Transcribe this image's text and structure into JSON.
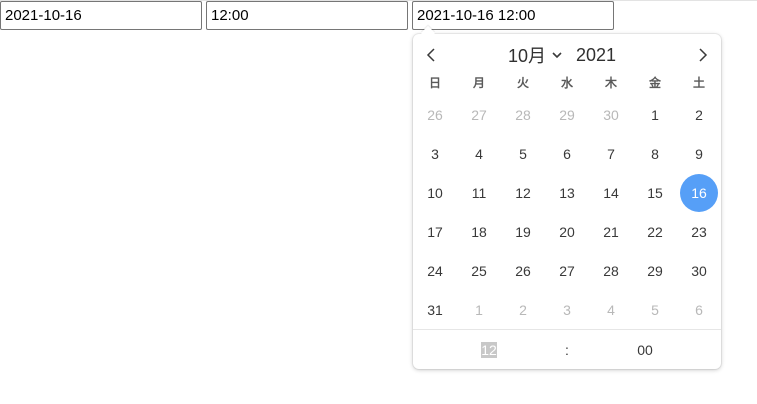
{
  "inputs": {
    "date_value": "2021-10-16",
    "time_value": "12:00",
    "datetime_value": "2021-10-16 12:00"
  },
  "picker": {
    "month_label": "10月",
    "year_value": "2021",
    "weekdays": [
      "日",
      "月",
      "火",
      "水",
      "木",
      "金",
      "土"
    ],
    "weeks": [
      [
        {
          "d": "26",
          "m": true
        },
        {
          "d": "27",
          "m": true
        },
        {
          "d": "28",
          "m": true
        },
        {
          "d": "29",
          "m": true
        },
        {
          "d": "30",
          "m": true
        },
        {
          "d": "1",
          "m": false
        },
        {
          "d": "2",
          "m": false
        }
      ],
      [
        {
          "d": "3",
          "m": false
        },
        {
          "d": "4",
          "m": false
        },
        {
          "d": "5",
          "m": false
        },
        {
          "d": "6",
          "m": false
        },
        {
          "d": "7",
          "m": false
        },
        {
          "d": "8",
          "m": false
        },
        {
          "d": "9",
          "m": false
        }
      ],
      [
        {
          "d": "10",
          "m": false
        },
        {
          "d": "11",
          "m": false
        },
        {
          "d": "12",
          "m": false
        },
        {
          "d": "13",
          "m": false
        },
        {
          "d": "14",
          "m": false
        },
        {
          "d": "15",
          "m": false
        },
        {
          "d": "16",
          "m": false,
          "sel": true
        }
      ],
      [
        {
          "d": "17",
          "m": false
        },
        {
          "d": "18",
          "m": false
        },
        {
          "d": "19",
          "m": false
        },
        {
          "d": "20",
          "m": false
        },
        {
          "d": "21",
          "m": false
        },
        {
          "d": "22",
          "m": false
        },
        {
          "d": "23",
          "m": false
        }
      ],
      [
        {
          "d": "24",
          "m": false
        },
        {
          "d": "25",
          "m": false
        },
        {
          "d": "26",
          "m": false
        },
        {
          "d": "27",
          "m": false
        },
        {
          "d": "28",
          "m": false
        },
        {
          "d": "29",
          "m": false
        },
        {
          "d": "30",
          "m": false
        }
      ],
      [
        {
          "d": "31",
          "m": false
        },
        {
          "d": "1",
          "m": true
        },
        {
          "d": "2",
          "m": true
        },
        {
          "d": "3",
          "m": true
        },
        {
          "d": "4",
          "m": true
        },
        {
          "d": "5",
          "m": true
        },
        {
          "d": "6",
          "m": true
        }
      ]
    ],
    "hour": "12",
    "separator": ":",
    "minute": "00"
  },
  "colors": {
    "selected_day": "#569ff7",
    "muted_day": "#b8b8b8",
    "hour_highlight": "#c8c8c8"
  },
  "icons": {
    "prev": "chevron-left-icon",
    "next": "chevron-right-icon",
    "month_dropdown": "chevron-down-icon"
  }
}
